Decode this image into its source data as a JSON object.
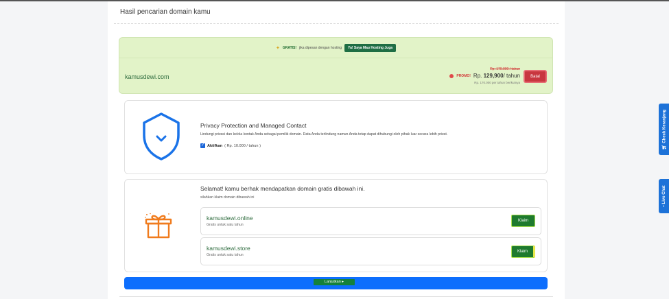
{
  "page": {
    "heading": "Hasil pencarian domain kamu"
  },
  "promo_banner": {
    "star_icon": "star-sparkle-icon",
    "gratis": "GRATIS!",
    "text": "jika dipesan dengan hosting",
    "button": "Ya! Saya Mau Hosting Juga"
  },
  "domain": {
    "name": "kamusdewi.com",
    "old_price": "Rp. 170.000 / tahun",
    "promo_label": "PROMO!",
    "price_prefix": "Rp.",
    "price": "129,900",
    "price_suffix": "/ tahun",
    "renewal": "Rp. 170.000 per tahun berikutnya",
    "cancel_button": "Batal"
  },
  "privacy": {
    "title": "Privacy Protection and Managed Contact",
    "description": "Lindungi privasi dan kelola kontak Anda sebagai pemilik domain. Data Anda terlindung namun Anda tetap dapat dihubungi oleh pihak luar secara lebih privat.",
    "checkbox_label": "Aktifkan",
    "checkbox_price": "( Rp. 10.000 / tahun )",
    "checked": true
  },
  "free_domains": {
    "title": "Selamat! kamu berhak mendapatkan domain gratis dibawah ini.",
    "subtitle": "silahkan klaim domain dibawah ini",
    "items": [
      {
        "name": "kamusdewi.online",
        "note": "Gratis untuk satu tahun",
        "button": "Klaim"
      },
      {
        "name": "kamusdewi.store",
        "note": "Gratis untuk satu tahun",
        "button": "Klaim"
      }
    ]
  },
  "continue_button": "Lanjutkan ▸",
  "side_tabs": [
    {
      "label": "Check Keranjang",
      "icon": "cart-icon"
    },
    {
      "label": "Live Chat",
      "icon": "chat-icon"
    }
  ],
  "colors": {
    "primary": "#0d6efd",
    "success": "#1e7a2e",
    "danger": "#c8363f",
    "domain_bg": "#e2f3c8",
    "shield": "#1a73e8",
    "gift": "#f07b1d"
  }
}
